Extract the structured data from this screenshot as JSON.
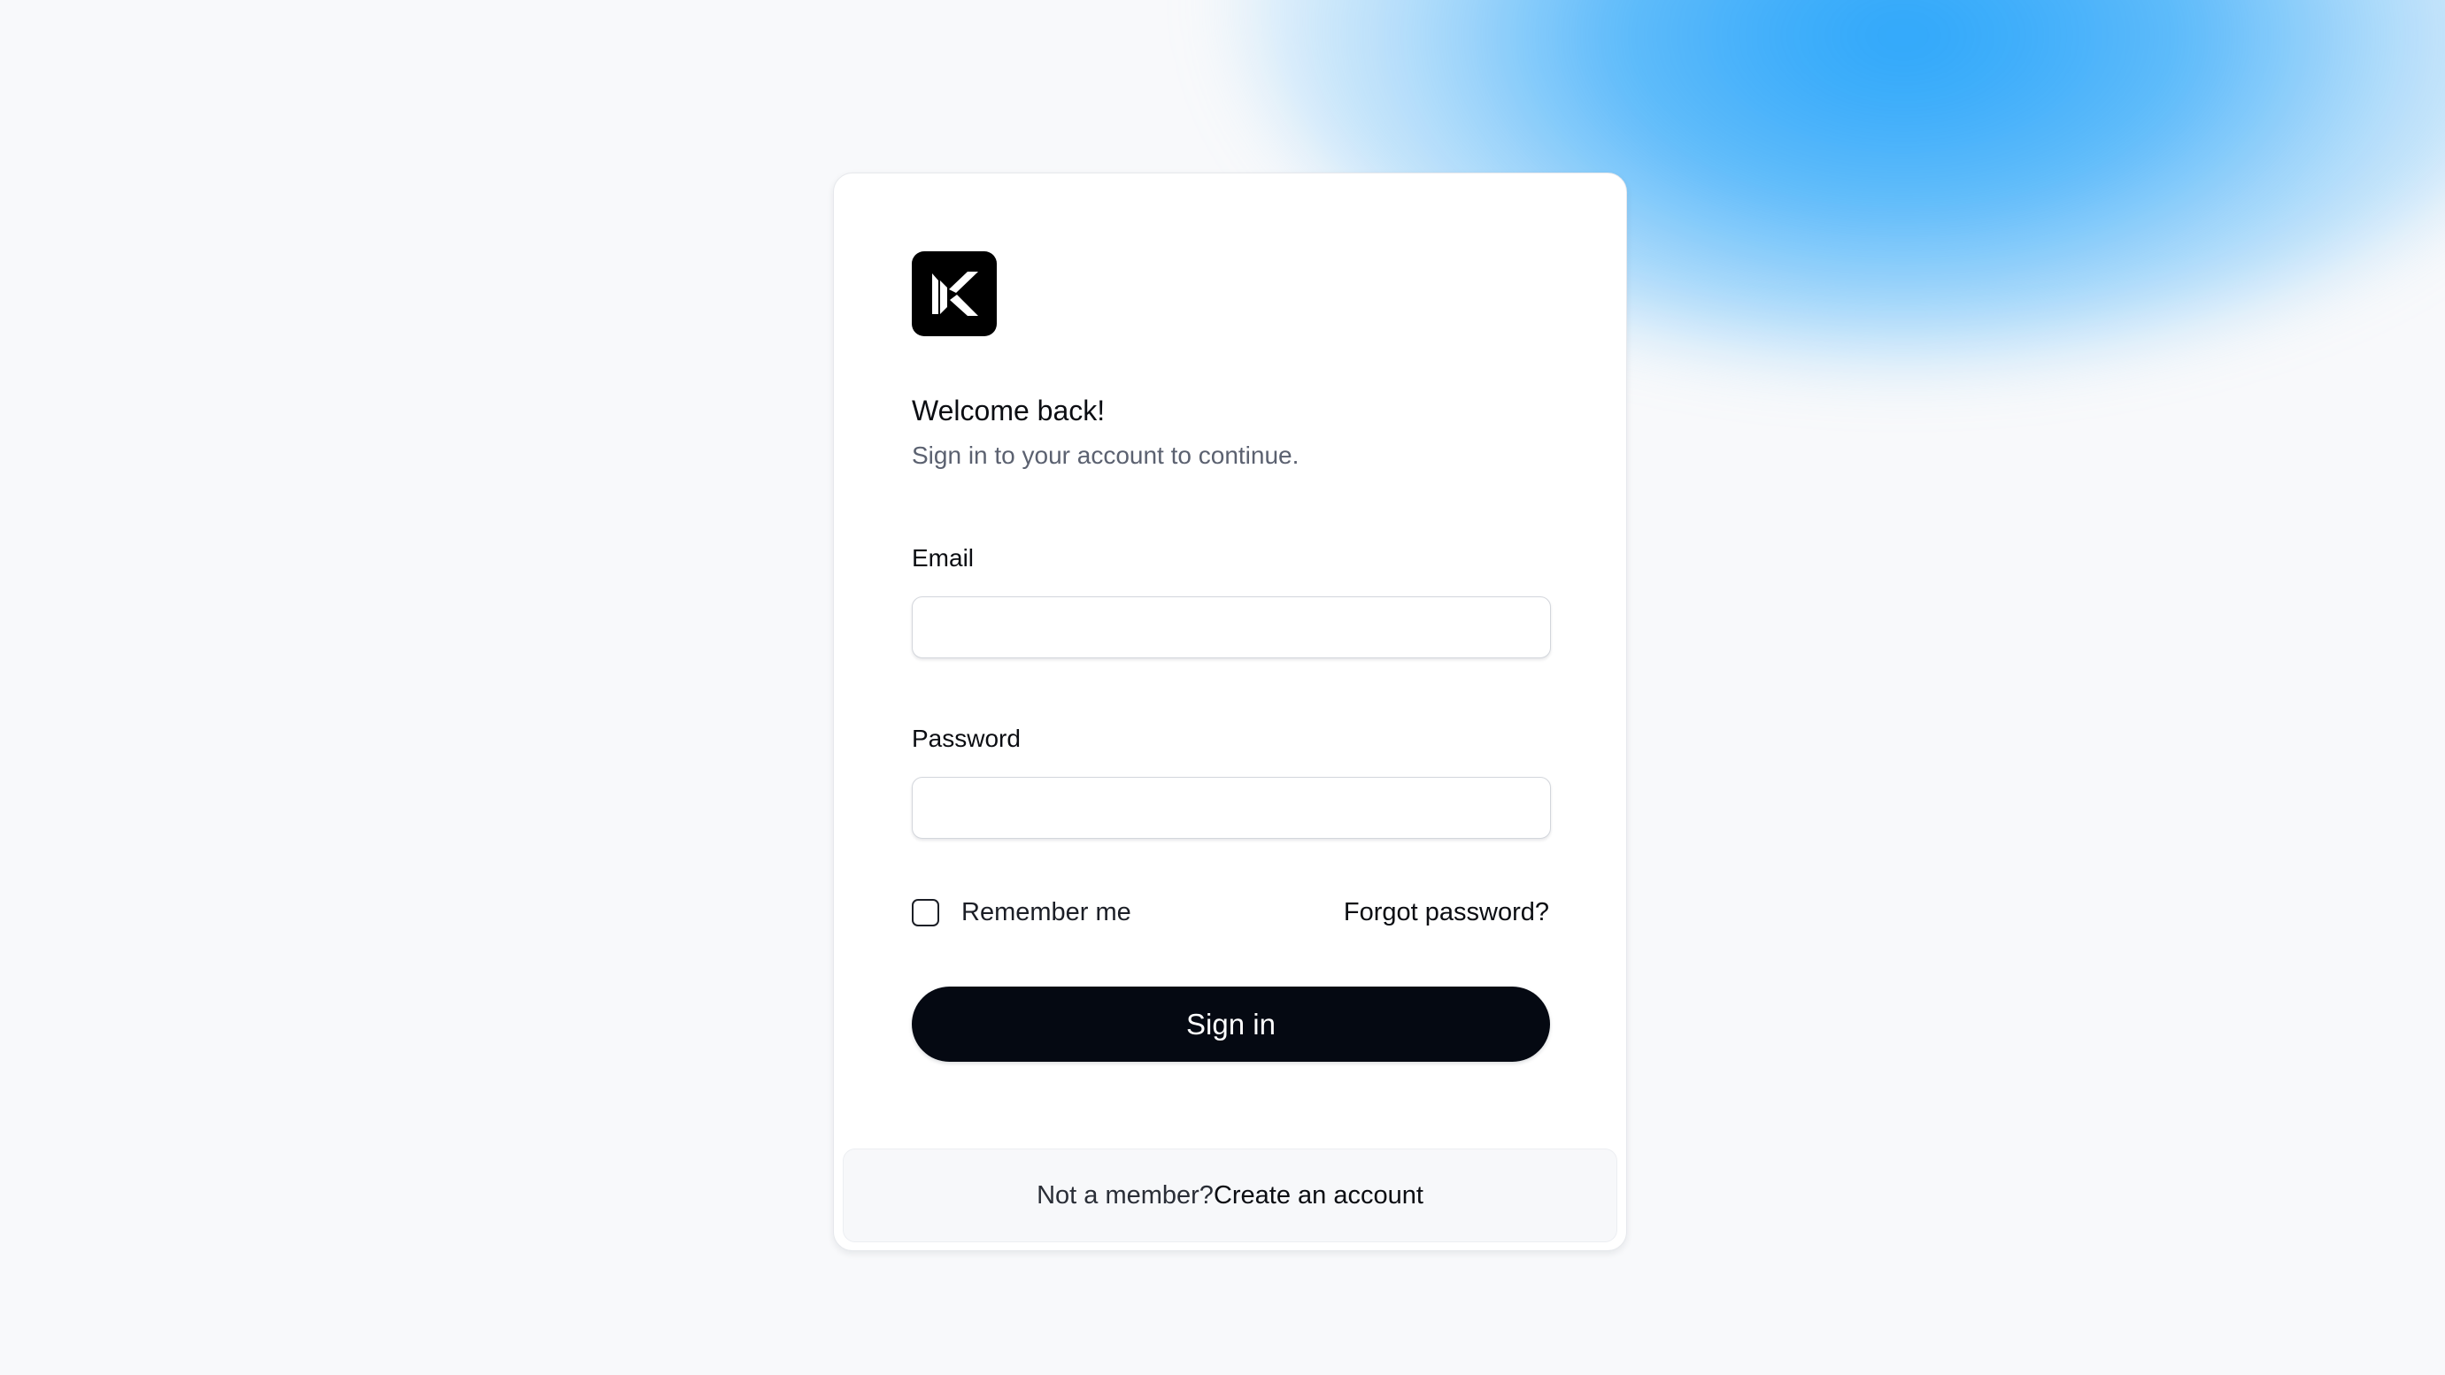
{
  "app": {
    "brand_letter": "K"
  },
  "header": {
    "title": "Welcome back!",
    "subtitle": "Sign in to your account to continue."
  },
  "form": {
    "email_label": "Email",
    "email_value": "",
    "password_label": "Password",
    "password_value": "",
    "remember_label": "Remember me",
    "remember_checked": false,
    "forgot_label": "Forgot password?",
    "submit_label": "Sign in"
  },
  "footer": {
    "prompt": "Not a member?",
    "link_label": "Create an account"
  },
  "colors": {
    "background": "#f8f9fb",
    "accent_glow": "#1ea0fa",
    "button": "#050912",
    "text_primary": "#0b0d12",
    "text_secondary": "#5b6170"
  },
  "icons": {
    "logo": "k-logo-icon"
  }
}
